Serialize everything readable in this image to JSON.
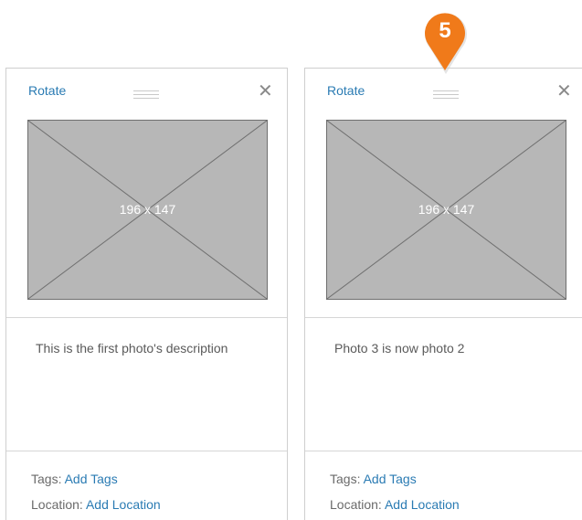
{
  "cards": [
    {
      "rotate_label": "Rotate",
      "photo_label": "196 x 147",
      "description": "This is the first photo's description",
      "tags_label": "Tags:",
      "tags_link": "Add Tags",
      "location_label": "Location:",
      "location_link": "Add Location"
    },
    {
      "rotate_label": "Rotate",
      "photo_label": "196 x 147",
      "description": "Photo 3 is now photo 2",
      "tags_label": "Tags:",
      "tags_link": "Add Tags",
      "location_label": "Location:",
      "location_link": "Add Location"
    }
  ],
  "step_marker": {
    "number": "5",
    "color": "#f07a1a"
  },
  "icons": {
    "close": "close-icon",
    "drag": "drag-handle-icon",
    "placeholder": "image-placeholder-icon",
    "marker": "map-pin-marker-icon"
  },
  "colors": {
    "link": "#2a7bb3",
    "border": "#cfcfcf",
    "placeholder_fill": "#b7b7b7"
  }
}
